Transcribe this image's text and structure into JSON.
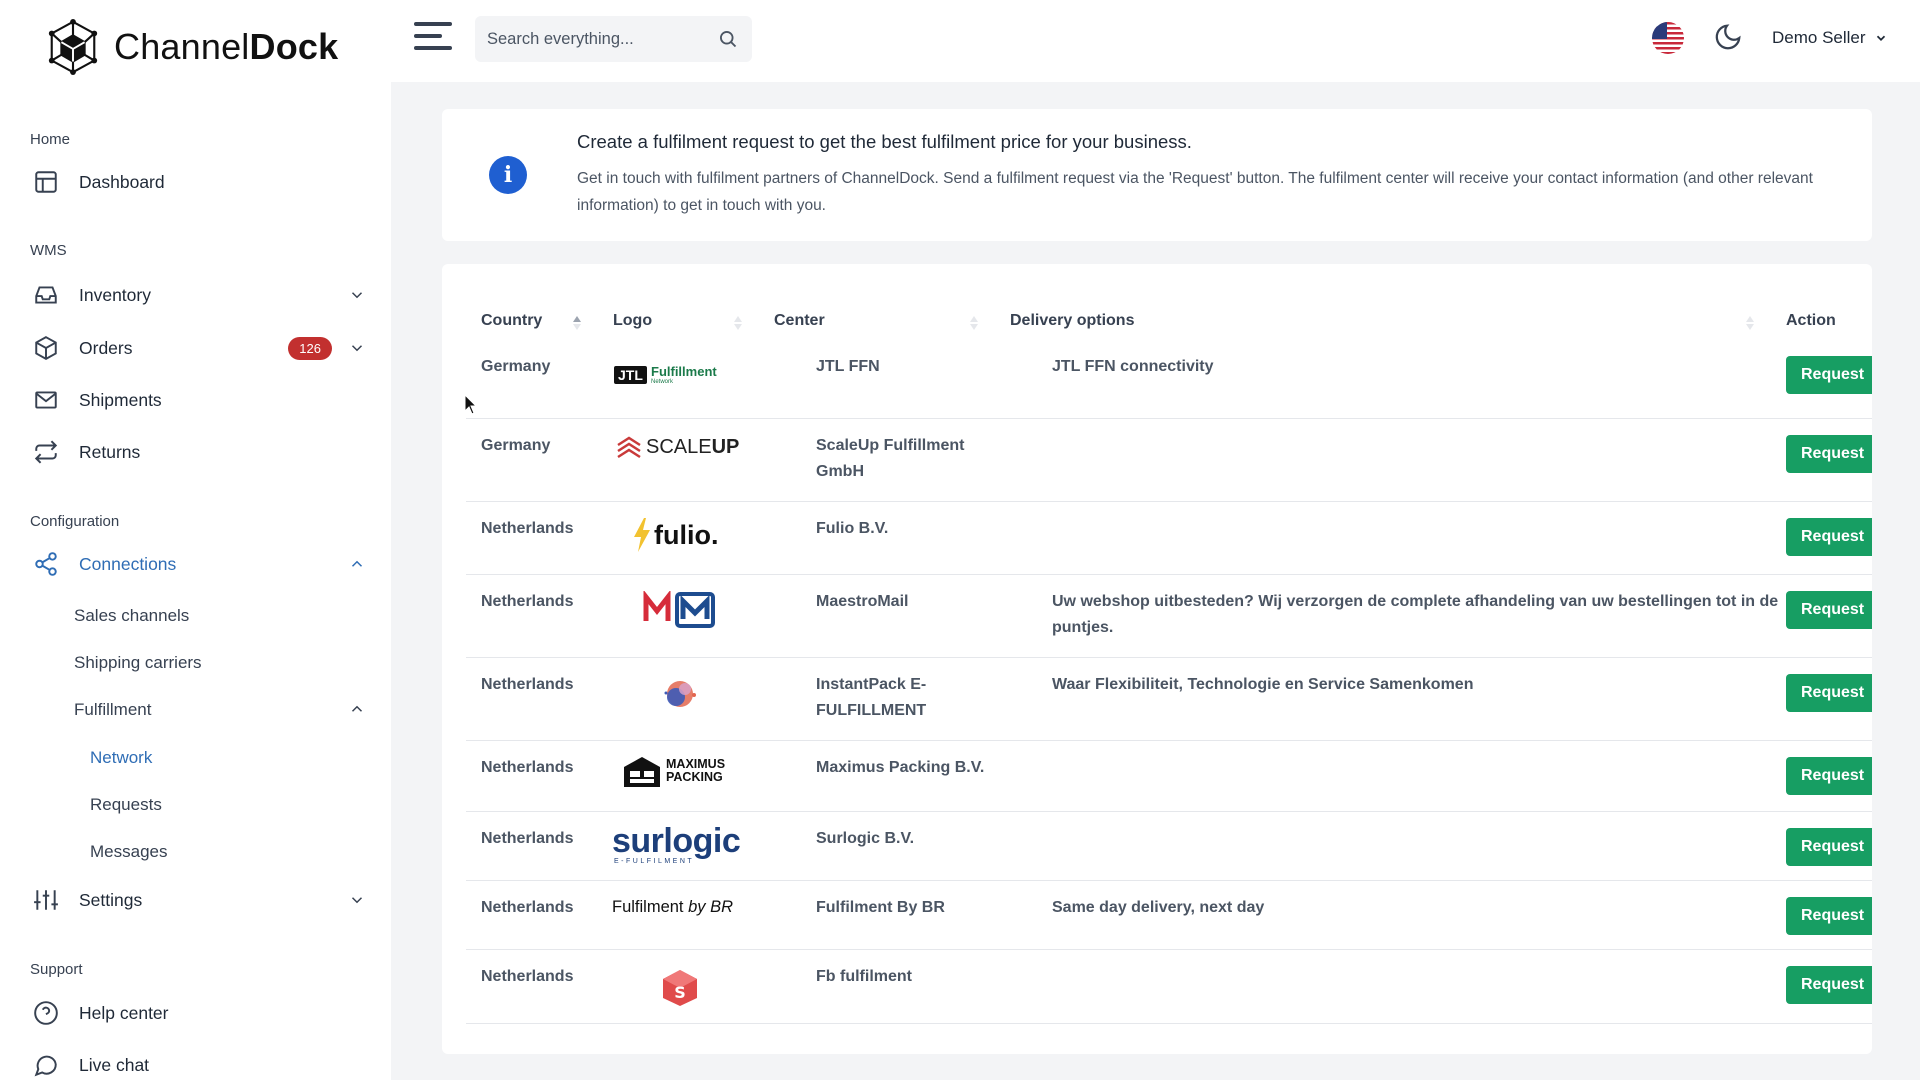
{
  "brand": {
    "name_regular": "Channel",
    "name_bold": "Dock"
  },
  "sidebar": {
    "sections": [
      "Home",
      "WMS",
      "Configuration",
      "Support"
    ],
    "items": [
      {
        "label": "Dashboard"
      },
      {
        "label": "Inventory"
      },
      {
        "label": "Orders",
        "badge": "126"
      },
      {
        "label": "Shipments"
      },
      {
        "label": "Returns"
      },
      {
        "label": "Connections"
      },
      {
        "label": "Settings"
      },
      {
        "label": "Help center"
      },
      {
        "label": "Live chat"
      }
    ],
    "connections_sub": [
      "Sales channels",
      "Shipping carriers",
      "Fulfillment"
    ],
    "fulfillment_sub": [
      "Network",
      "Requests",
      "Messages"
    ]
  },
  "topbar": {
    "search_placeholder": "Search everything...",
    "user": "Demo Seller"
  },
  "info": {
    "title": "Create a fulfilment request to get the best fulfilment price for your business.",
    "text": "Get in touch with fulfilment partners of ChannelDock. Send a fulfilment request via the 'Request' button. The fulfilment center will receive your contact information (and other relevant information) to get in touch with you."
  },
  "table": {
    "headers": {
      "country": "Country",
      "logo": "Logo",
      "center": "Center",
      "delivery": "Delivery options",
      "action": "Action"
    },
    "button_label": "Request",
    "rows": [
      {
        "country": "Germany",
        "center": "JTL FFN",
        "delivery": "JTL FFN connectivity",
        "logo": "jtl"
      },
      {
        "country": "Germany",
        "center": "ScaleUp Fulfillment GmbH",
        "delivery": "",
        "logo": "scaleup"
      },
      {
        "country": "Netherlands",
        "center": "Fulio B.V.",
        "delivery": "",
        "logo": "fulio"
      },
      {
        "country": "Netherlands",
        "center": "MaestroMail",
        "delivery": "Uw webshop uitbesteden? Wij verzorgen de complete afhandeling van uw bestellingen tot in de puntjes.",
        "logo": "mm"
      },
      {
        "country": "Netherlands",
        "center": "InstantPack E-FULFILLMENT",
        "delivery": "Waar Flexibiliteit, Technologie en Service Samenkomen",
        "logo": "instantpack"
      },
      {
        "country": "Netherlands",
        "center": "Maximus Packing B.V.",
        "delivery": "",
        "logo": "maximus"
      },
      {
        "country": "Netherlands",
        "center": "Surlogic B.V.",
        "delivery": "",
        "logo": "surlogic"
      },
      {
        "country": "Netherlands",
        "center": "Fulfilment By BR",
        "delivery": "Same day delivery, next day",
        "logo": "br"
      },
      {
        "country": "Netherlands",
        "center": "Fb fulfilment",
        "delivery": "",
        "logo": "fb"
      }
    ]
  },
  "logo_texts": {
    "jtl_mark": "JTL",
    "jtl_word": "Fulfillment",
    "jtl_sub": "Network",
    "scaleup_a": "SCALE",
    "scaleup_b": "UP",
    "fulio": "fulio.",
    "maximus_1": "MAXIMUS",
    "maximus_2": "PACKING",
    "surlogic": "surlogic",
    "surlogic_sub": "E-FULFILMENT",
    "br_a": "Fulfilment ",
    "br_b": "by BR"
  },
  "colors": {
    "accent": "#2f6db5",
    "button": "#179e63",
    "badge": "#c2302f",
    "info": "#1f5fd1"
  }
}
